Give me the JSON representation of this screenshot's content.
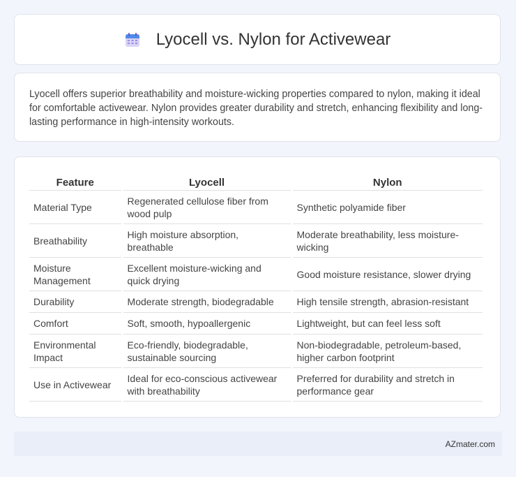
{
  "header": {
    "title": "Lyocell vs. Nylon for Activewear",
    "icon": "calendar-icon"
  },
  "summary": "Lyocell offers superior breathability and moisture-wicking properties compared to nylon, making it ideal for comfortable activewear. Nylon provides greater durability and stretch, enhancing flexibility and long-lasting performance in high-intensity workouts.",
  "table": {
    "headers": [
      "Feature",
      "Lyocell",
      "Nylon"
    ],
    "rows": [
      [
        "Material Type",
        "Regenerated cellulose fiber from wood pulp",
        "Synthetic polyamide fiber"
      ],
      [
        "Breathability",
        "High moisture absorption, breathable",
        "Moderate breathability, less moisture-wicking"
      ],
      [
        "Moisture Management",
        "Excellent moisture-wicking and quick drying",
        "Good moisture resistance, slower drying"
      ],
      [
        "Durability",
        "Moderate strength, biodegradable",
        "High tensile strength, abrasion-resistant"
      ],
      [
        "Comfort",
        "Soft, smooth, hypoallergenic",
        "Lightweight, but can feel less soft"
      ],
      [
        "Environmental Impact",
        "Eco-friendly, biodegradable, sustainable sourcing",
        "Non-biodegradable, petroleum-based, higher carbon footprint"
      ],
      [
        "Use in Activewear",
        "Ideal for eco-conscious activewear with breathability",
        "Preferred for durability and stretch in performance gear"
      ]
    ]
  },
  "footer": {
    "brand": "AZmater.com"
  }
}
